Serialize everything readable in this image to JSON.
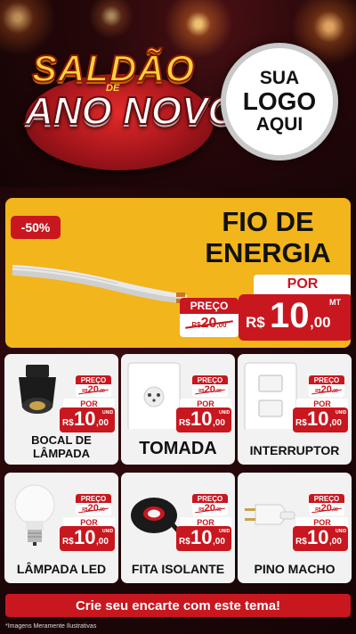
{
  "header": {
    "title_line1": "SALDÃO",
    "title_connector": "DE",
    "title_line2": "ANO NOVO",
    "logo_line1": "SUA",
    "logo_line2": "LOGO",
    "logo_line3": "AQUI"
  },
  "hero": {
    "discount_badge": "-50%",
    "product_name": "FIO DE ENERGIA",
    "por_label": "POR",
    "preco_label": "PREÇO",
    "old_price_currency": "R$",
    "old_price": "20",
    "old_price_cents": ",00",
    "currency": "R$",
    "price_int": "10",
    "price_cents": ",00",
    "unit": "MT"
  },
  "products": [
    {
      "name": "BOCAL DE LÂMPADA",
      "preco_label": "PREÇO",
      "old_currency": "R$",
      "old_price": "20",
      "old_cents": ",00",
      "por_label": "POR",
      "currency": "R$",
      "price_int": "10",
      "price_cents": ",00",
      "unit": "UNID"
    },
    {
      "name": "TOMADA",
      "preco_label": "PREÇO",
      "old_currency": "R$",
      "old_price": "20",
      "old_cents": ",00",
      "por_label": "POR",
      "currency": "R$",
      "price_int": "10",
      "price_cents": ",00",
      "unit": "UNID"
    },
    {
      "name": "INTERRUPTOR",
      "preco_label": "PREÇO",
      "old_currency": "R$",
      "old_price": "20",
      "old_cents": ",00",
      "por_label": "POR",
      "currency": "R$",
      "price_int": "10",
      "price_cents": ",00",
      "unit": "UNID"
    },
    {
      "name": "LÂMPADA LED",
      "preco_label": "PREÇO",
      "old_currency": "R$",
      "old_price": "20",
      "old_cents": ",00",
      "por_label": "POR",
      "currency": "R$",
      "price_int": "10",
      "price_cents": ",00",
      "unit": "UNID"
    },
    {
      "name": "FITA ISOLANTE",
      "preco_label": "PREÇO",
      "old_currency": "R$",
      "old_price": "20",
      "old_cents": ",00",
      "por_label": "POR",
      "currency": "R$",
      "price_int": "10",
      "price_cents": ",00",
      "unit": "UNID"
    },
    {
      "name": "PINO MACHO",
      "preco_label": "PREÇO",
      "old_currency": "R$",
      "old_price": "20",
      "old_cents": ",00",
      "por_label": "POR",
      "currency": "R$",
      "price_int": "10",
      "price_cents": ",00",
      "unit": "UNID"
    }
  ],
  "icons": [
    "cable-icon",
    "lamp-socket-icon",
    "power-outlet-icon",
    "light-switch-icon",
    "led-bulb-icon",
    "insulating-tape-icon",
    "plug-icon"
  ],
  "cta": "Crie seu encarte com este tema!",
  "footnote": "*Imagens Meramente Ilustrativas",
  "colors": {
    "accent_red": "#c8171f",
    "hero_yellow": "#f2b51b",
    "title_gold": "#ffd23a",
    "card_bg": "#f2f2f2"
  }
}
